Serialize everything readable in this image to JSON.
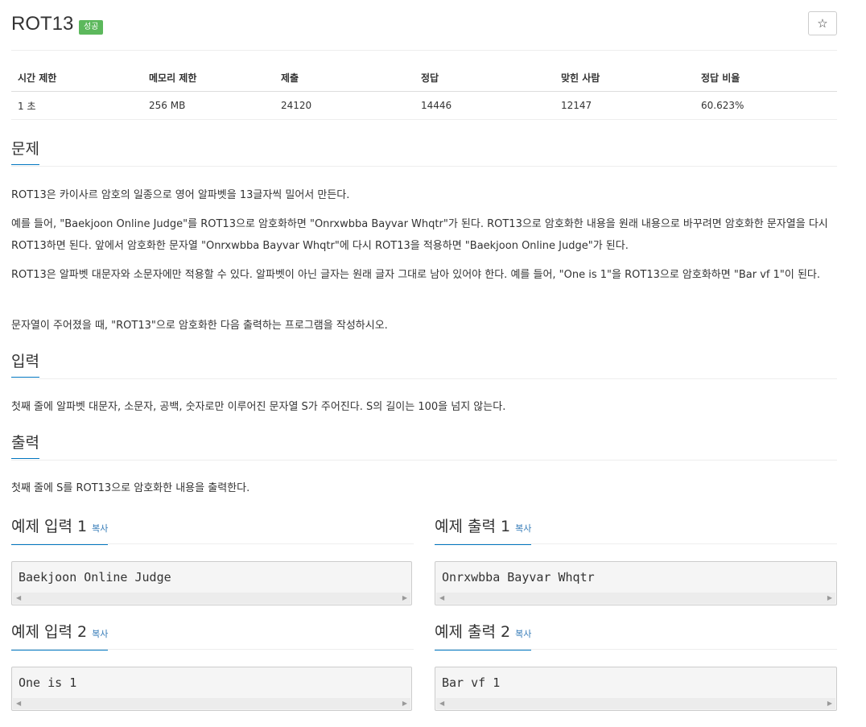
{
  "header": {
    "title": "ROT13",
    "badge": "성공",
    "star": "☆"
  },
  "info": {
    "headers": [
      "시간 제한",
      "메모리 제한",
      "제출",
      "정답",
      "맞힌 사람",
      "정답 비율"
    ],
    "values": [
      "1 초",
      "256 MB",
      "24120",
      "14446",
      "12147",
      "60.623%"
    ]
  },
  "problem": {
    "heading": "문제",
    "p1": "ROT13은 카이사르 암호의 일종으로 영어 알파벳을 13글자씩 밀어서 만든다.",
    "p2": "예를 들어, \"Baekjoon Online Judge\"를 ROT13으로 암호화하면 \"Onrxwbba Bayvar Whqtr\"가 된다. ROT13으로 암호화한 내용을 원래 내용으로 바꾸려면 암호화한 문자열을 다시 ROT13하면 된다. 앞에서 암호화한 문자열 \"Onrxwbba Bayvar Whqtr\"에 다시 ROT13을 적용하면 \"Baekjoon Online Judge\"가 된다.",
    "p3": "ROT13은 알파벳 대문자와 소문자에만 적용할 수 있다. 알파벳이 아닌 글자는 원래 글자 그대로 남아 있어야 한다. 예를 들어, \"One is 1\"을 ROT13으로 암호화하면 \"Bar vf 1\"이 된다.",
    "p4": "문자열이 주어졌을 때, \"ROT13\"으로 암호화한 다음 출력하는 프로그램을 작성하시오."
  },
  "input": {
    "heading": "입력",
    "text": "첫째 줄에 알파벳 대문자, 소문자, 공백, 숫자로만 이루어진 문자열 S가 주어진다. S의 길이는 100을 넘지 않는다."
  },
  "output": {
    "heading": "출력",
    "text": "첫째 줄에 S를 ROT13으로 암호화한 내용을 출력한다."
  },
  "examples": {
    "copy_label": "복사",
    "in1_title": "예제 입력 1",
    "out1_title": "예제 출력 1",
    "in2_title": "예제 입력 2",
    "out2_title": "예제 출력 2",
    "in1": "Baekjoon Online Judge",
    "out1": "Onrxwbba Bayvar Whqtr",
    "in2": "One is 1",
    "out2": "Bar vf 1"
  }
}
